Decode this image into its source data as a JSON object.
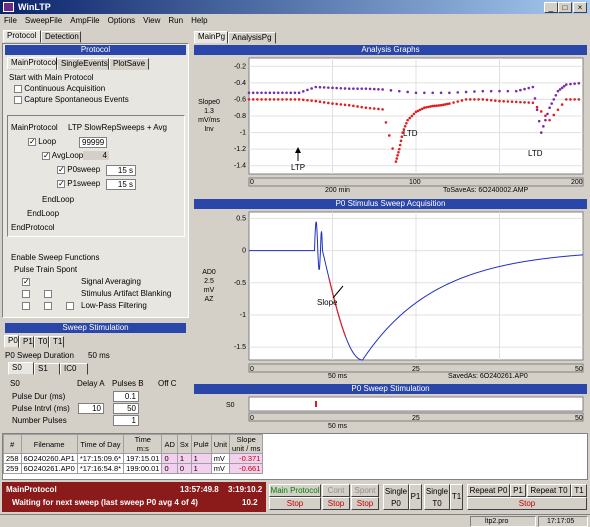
{
  "window": {
    "title": "WinLTP",
    "min": "_",
    "max": "□",
    "close": "×"
  },
  "menu": [
    "File",
    "SweepFile",
    "AmpFile",
    "Options",
    "View",
    "Run",
    "Help"
  ],
  "left_tabs": [
    "Protocol",
    "Detection"
  ],
  "protocol_header": "Protocol",
  "protocol_tabs": [
    "MainProtocol",
    "SingleEvents",
    "PlotSave"
  ],
  "start": {
    "title": "Start with Main Protocol",
    "continuous": "Continuous Acquisition",
    "capture": "Capture Spontaneous Events"
  },
  "main_protocol": {
    "label": "MainProtocol",
    "mode": "LTP SlowRepSweeps + Avg",
    "loop": "Loop",
    "loop_count": "99999",
    "avgloop": "AvgLoop",
    "avgloop_count": "4",
    "p0sweep": "P0sweep",
    "p0_time": "15 s",
    "p1sweep": "P1sweep",
    "p1_time": "15 s",
    "endloop1": "EndLoop",
    "endloop2": "EndLoop",
    "endloop3": "EndProtocol"
  },
  "sweep_functions": {
    "title": "Enable Sweep Functions",
    "cols": "Pulse  Train  Spont",
    "items": [
      "Signal Averaging",
      "Stimulus Artifact Blanking",
      "Low-Pass Filtering"
    ]
  },
  "sweep_stim": {
    "header": "Sweep Stimulation",
    "tabs": [
      "P0",
      "P1",
      "T0",
      "T1"
    ],
    "duration_label": "P0 Sweep Duration",
    "duration": "50 ms",
    "sub_tabs": [
      "S0",
      "S1",
      "IC0"
    ],
    "col_s0": "S0",
    "col_a": "Delay A",
    "col_b": "Pulses B",
    "col_off": "Off C",
    "rows": [
      {
        "label": "Pulse Dur (ms)",
        "a": "",
        "b": "0.1"
      },
      {
        "label": "Pulse Intrvl (ms)",
        "a": "10",
        "b": "50"
      },
      {
        "label": "Number Pulses",
        "a": "",
        "b": "1"
      }
    ]
  },
  "right_tabs": [
    "MainPg",
    "AnalysisPg"
  ],
  "analysis": {
    "header": "Analysis Graphs",
    "ylabel": [
      "Slope0",
      "1.3",
      "mV/ms",
      "Inv"
    ],
    "yticks": [
      "-1.4",
      "-1.2",
      "-1",
      "-0.8",
      "-0.6",
      "-0.4",
      "-0.2"
    ],
    "xticks": [
      "0",
      "100",
      "200"
    ],
    "xinfo": "200 min",
    "file": "ToSaveAs: 6O240002.AMP",
    "ann_ltp": "LTP",
    "ann_ltd1": "LTD",
    "ann_ltd2": "LTD"
  },
  "p0acq": {
    "header": "P0 Stimulus Sweep Acquisition",
    "ylabel": [
      "AD0",
      "2.5",
      "mV",
      "AZ"
    ],
    "yticks": [
      "0.5",
      "0",
      "-0.5",
      "-1",
      "-1.5"
    ],
    "xticks": [
      "0",
      "25",
      "50"
    ],
    "xinfo": "50 ms",
    "file": "SavedAs: 6O240261.AP0",
    "slope": "Slope"
  },
  "p0stim": {
    "header": "P0 Sweep Stimulation",
    "s0": "S0",
    "xticks": [
      "0",
      "25",
      "50"
    ],
    "xinfo": "50 ms"
  },
  "table": {
    "headers": [
      "#",
      "Filename",
      "Time of Day",
      "Time\nm:s",
      "AD",
      "Sx",
      "Pul#",
      "Unit",
      "Slope\nunit / ms"
    ],
    "rows": [
      [
        "258",
        "6O240260.AP1",
        "*17:15:09.6*",
        "197:15.01",
        "0",
        "1",
        "1",
        "mV",
        "-0.371"
      ],
      [
        "259",
        "6O240261.AP0",
        "*17:16:54.8*",
        "199:00.01",
        "0",
        "0",
        "1",
        "mV",
        "-0.661"
      ]
    ]
  },
  "status": {
    "protocol": "MainProtocol",
    "clock": "13:57:49.8",
    "elapsed": "3:19:10.2",
    "message": "Waiting for next sweep  (last sweep P0 avg 4 of 4)",
    "count": "10.2"
  },
  "buttons": {
    "main_protocol": "Main Protocol",
    "stop": "Stop",
    "cont": "Cont",
    "spont": "Spont",
    "single_p0": "Single P0",
    "p1": "P1",
    "single_t0": "Single T0",
    "t1": "T1",
    "repeat_p0": "Repeat P0",
    "rp1": "P1",
    "repeat_t0": "Repeat T0",
    "rt1": "T1"
  },
  "statusbar": {
    "file": "ltp2.pro",
    "time": "17:17:05"
  },
  "chart_data": [
    {
      "type": "scatter",
      "title": "Analysis Graphs",
      "xlim": [
        0,
        200
      ],
      "ylim": [
        -1.5,
        -0.1
      ],
      "series": [
        {
          "color": "#e02020",
          "x": [
            0,
            10,
            20,
            30,
            40,
            50,
            60,
            70,
            80,
            88,
            90,
            92,
            95,
            100,
            105,
            110,
            115,
            120,
            130,
            140,
            150,
            160,
            170,
            180,
            190,
            200
          ],
          "values": [
            -0.6,
            -0.6,
            -0.6,
            -0.6,
            -0.62,
            -0.65,
            -0.67,
            -0.7,
            -0.72,
            -1.35,
            -1.2,
            -1.0,
            -0.85,
            -0.75,
            -0.7,
            -0.68,
            -0.67,
            -0.65,
            -0.6,
            -0.6,
            -0.62,
            -0.63,
            -0.64,
            -0.85,
            -0.6,
            -0.6
          ]
        },
        {
          "color": "#7b2aa8",
          "x": [
            0,
            10,
            20,
            30,
            40,
            50,
            60,
            70,
            80,
            100,
            120,
            140,
            160,
            170,
            175,
            180,
            185,
            190,
            200
          ],
          "values": [
            -0.52,
            -0.52,
            -0.52,
            -0.52,
            -0.45,
            -0.46,
            -0.47,
            -0.47,
            -0.48,
            -0.52,
            -0.52,
            -0.5,
            -0.5,
            -0.45,
            -1.0,
            -0.7,
            -0.5,
            -0.42,
            -0.4
          ]
        }
      ]
    },
    {
      "type": "line",
      "title": "P0 Stimulus Sweep Acquisition",
      "xlim": [
        0,
        50
      ],
      "ylim": [
        -1.7,
        0.6
      ]
    }
  ]
}
